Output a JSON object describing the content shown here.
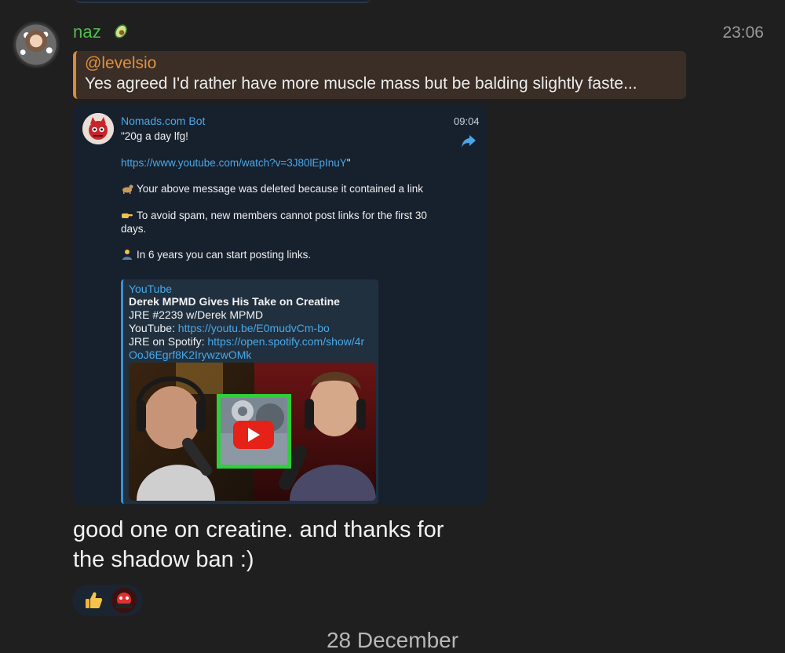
{
  "message": {
    "sender": "naz",
    "time": "23:06",
    "reply": {
      "name": "@levelsio",
      "text": "Yes agreed  I'd rather have more muscle mass but be balding slightly faste..."
    },
    "forwarded": {
      "bot_name": "Nomads.com Bot",
      "time": "09:04",
      "line1": "\"20g a day lfg!",
      "link": "https://www.youtube.com/watch?v=3J80lEpInuY",
      "link_tail": "\"",
      "deleted_notice": "Your above message was deleted because it contained a link",
      "spam_notice": "To avoid spam, new members cannot post links for the first 30 days.",
      "years_notice": "In 6 years you can start posting links.",
      "preview": {
        "site": "YouTube",
        "title": "Derek MPMD Gives His Take on Creatine",
        "line1": "JRE #2239 w/Derek MPMD",
        "yt_label": "YouTube: ",
        "yt_link": "https://youtu.be/E0mudvCm-bo",
        "spotify_label": "JRE on Spotify: ",
        "spotify_link": "https://open.spotify.com/show/4rOoJ6Egrf8K2IrywzwOMk"
      }
    },
    "text_line1": "good one on creatine. and thanks for",
    "text_line2": "the shadow ban :)"
  },
  "date_separator": "28 December",
  "icons": {
    "sender_emoji": "avocado-icon",
    "share": "share-arrow-icon",
    "reaction": "thumbs-up-icon"
  },
  "colors": {
    "sender": "#4fbf4f",
    "reply_accent": "#d98a3a",
    "link": "#4aa8e8",
    "background": "#1f1f1f"
  }
}
